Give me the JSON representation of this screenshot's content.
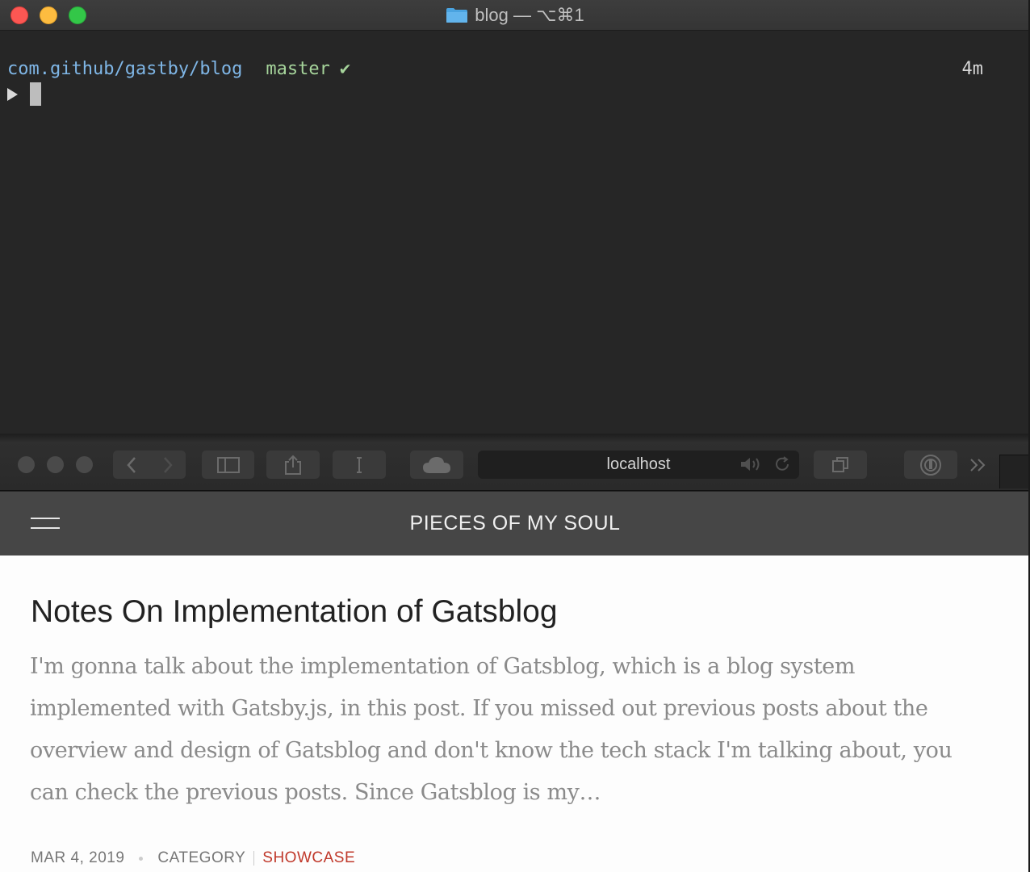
{
  "terminal": {
    "title": "blog — ⌥⌘1",
    "prompt_path": "com.github/gastby/blog",
    "prompt_branch": "master",
    "prompt_status": "✔",
    "prompt_elapsed": "4m"
  },
  "browser": {
    "address": "localhost"
  },
  "site": {
    "title": "PIECES OF MY SOUL",
    "post": {
      "title": "Notes On Implementation of Gatsblog",
      "excerpt": "I'm gonna talk about the implementation of Gatsblog, which is a blog system implemented with Gatsby.js, in this post. If you missed out previous posts about the overview and design of Gatsblog and don't know the tech stack I'm talking about, you can check the previous posts. Since Gatsblog is my…",
      "date": "MAR 4, 2019",
      "category_label": "CATEGORY",
      "category": "SHOWCASE"
    }
  },
  "colors": {
    "prompt_path": "#7fb6e6",
    "prompt_branch": "#a6d49b",
    "category": "#c0392b"
  },
  "icons": [
    "folder-icon",
    "back-icon",
    "forward-icon",
    "sidebar-icon",
    "share-icon",
    "reader-icon",
    "cloud-icon",
    "mute-icon",
    "reload-icon",
    "tabs-icon",
    "password-icon",
    "more-icon",
    "hamburger-icon"
  ]
}
